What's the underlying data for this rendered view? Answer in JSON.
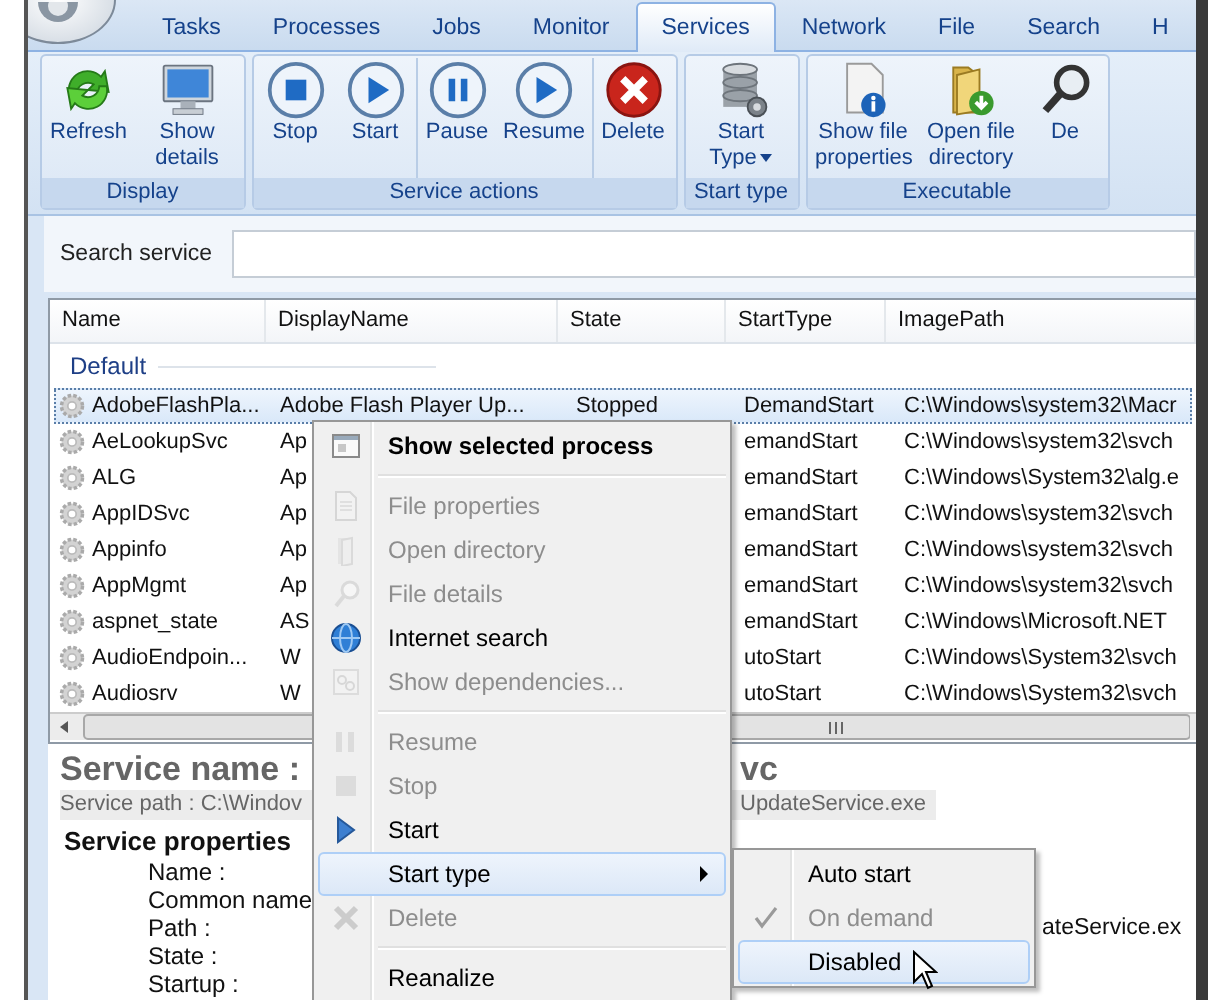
{
  "tabs": [
    {
      "label": "Tasks",
      "selected": false
    },
    {
      "label": "Processes",
      "selected": false
    },
    {
      "label": "Jobs",
      "selected": false
    },
    {
      "label": "Monitor",
      "selected": false
    },
    {
      "label": "Services",
      "selected": true
    },
    {
      "label": "Network",
      "selected": false
    },
    {
      "label": "File",
      "selected": false
    },
    {
      "label": "Search",
      "selected": false
    },
    {
      "label": "H",
      "selected": false
    }
  ],
  "ribbon_groups": [
    {
      "title": "Display",
      "sections": [
        [
          {
            "label": "Refresh",
            "kind": "refresh"
          },
          {
            "label": "Show details",
            "kind": "monitor"
          }
        ]
      ]
    },
    {
      "title": "Service actions",
      "sections": [
        [
          {
            "label": "Stop",
            "kind": "stop"
          },
          {
            "label": "Start",
            "kind": "play"
          }
        ],
        [
          {
            "label": "Pause",
            "kind": "pause"
          },
          {
            "label": "Resume",
            "kind": "play"
          }
        ],
        [
          {
            "label": "Delete",
            "kind": "delete"
          }
        ]
      ]
    },
    {
      "title": "Start type",
      "sections": [
        [
          {
            "label": "Start Type",
            "kind": "database",
            "dropdown": true
          }
        ]
      ]
    },
    {
      "title": "Executable",
      "sections": [
        [
          {
            "label": "Show file properties",
            "kind": "fileinfo"
          },
          {
            "label": "Open file directory",
            "kind": "folder"
          },
          {
            "label": "De",
            "kind": "magnifier"
          }
        ]
      ]
    }
  ],
  "search": {
    "label": "Search service"
  },
  "table": {
    "columns": [
      "Name",
      "DisplayName",
      "State",
      "StartType",
      "ImagePath"
    ],
    "group": "Default",
    "rows": [
      {
        "selected": true,
        "cells": [
          "AdobeFlashPla...",
          "Adobe Flash Player Up...",
          "Stopped",
          "DemandStart",
          "C:\\Windows\\system32\\Macr"
        ]
      },
      {
        "selected": false,
        "cells": [
          "AeLookupSvc",
          "Ap",
          null,
          "emandStart",
          "C:\\Windows\\system32\\svch"
        ]
      },
      {
        "selected": false,
        "cells": [
          "ALG",
          "Ap",
          null,
          "emandStart",
          "C:\\Windows\\System32\\alg.e"
        ]
      },
      {
        "selected": false,
        "cells": [
          "AppIDSvc",
          "Ap",
          null,
          "emandStart",
          "C:\\Windows\\system32\\svch"
        ]
      },
      {
        "selected": false,
        "cells": [
          "Appinfo",
          "Ap",
          null,
          "emandStart",
          "C:\\Windows\\system32\\svch"
        ]
      },
      {
        "selected": false,
        "cells": [
          "AppMgmt",
          "Ap",
          null,
          "emandStart",
          "C:\\Windows\\system32\\svch"
        ]
      },
      {
        "selected": false,
        "cells": [
          "aspnet_state",
          "AS",
          null,
          "emandStart",
          "C:\\Windows\\Microsoft.NET"
        ]
      },
      {
        "selected": false,
        "cells": [
          "AudioEndpoin...",
          "W",
          null,
          "utoStart",
          "C:\\Windows\\System32\\svch"
        ]
      },
      {
        "selected": false,
        "cells": [
          "Audiosrv",
          "W",
          null,
          "utoStart",
          "C:\\Windows\\System32\\svch"
        ]
      }
    ]
  },
  "details": {
    "service_name_label": "Service name :",
    "service_name_tail": "vc",
    "path_label": "Service path : C:\\Windov",
    "path_tail": "UpdateService.exe",
    "properties_title": "Service properties",
    "properties": [
      {
        "label": "Name :"
      },
      {
        "label": "Common name"
      },
      {
        "label": "Path :",
        "value": "ateService.ex"
      },
      {
        "label": "State :"
      },
      {
        "label": "Startup :"
      }
    ]
  },
  "context_menu": {
    "items": [
      {
        "kind": "item",
        "label": "Show selected process",
        "disabled": false,
        "bold": true,
        "highlighted": false
      },
      {
        "kind": "separator"
      },
      {
        "kind": "item",
        "label": "File properties",
        "disabled": true,
        "bold": false,
        "highlighted": false
      },
      {
        "kind": "item",
        "label": "Open directory",
        "disabled": true,
        "bold": false,
        "highlighted": false
      },
      {
        "kind": "item",
        "label": "File details",
        "disabled": true,
        "bold": false,
        "highlighted": false
      },
      {
        "kind": "item",
        "label": "Internet search",
        "disabled": false,
        "bold": false,
        "highlighted": false
      },
      {
        "kind": "item",
        "label": "Show dependencies...",
        "disabled": true,
        "bold": false,
        "highlighted": false
      },
      {
        "kind": "separator"
      },
      {
        "kind": "item",
        "label": "Resume",
        "disabled": true,
        "bold": false,
        "highlighted": false
      },
      {
        "kind": "item",
        "label": "Stop",
        "disabled": true,
        "bold": false,
        "highlighted": false
      },
      {
        "kind": "item",
        "label": "Start",
        "disabled": false,
        "bold": false,
        "highlighted": false
      },
      {
        "kind": "item",
        "label": "Start type",
        "disabled": false,
        "bold": false,
        "highlighted": true,
        "submenu": true
      },
      {
        "kind": "item",
        "label": "Delete",
        "disabled": true,
        "bold": false,
        "highlighted": false
      },
      {
        "kind": "separator"
      },
      {
        "kind": "item",
        "label": "Reanalize",
        "disabled": false,
        "bold": false,
        "highlighted": false
      }
    ]
  },
  "submenu": {
    "items": [
      {
        "label": "Auto start",
        "checked": false,
        "disabled": false,
        "highlighted": false
      },
      {
        "label": "On demand",
        "checked": true,
        "disabled": true,
        "highlighted": false
      },
      {
        "label": "Disabled",
        "checked": false,
        "disabled": false,
        "highlighted": true
      }
    ]
  }
}
